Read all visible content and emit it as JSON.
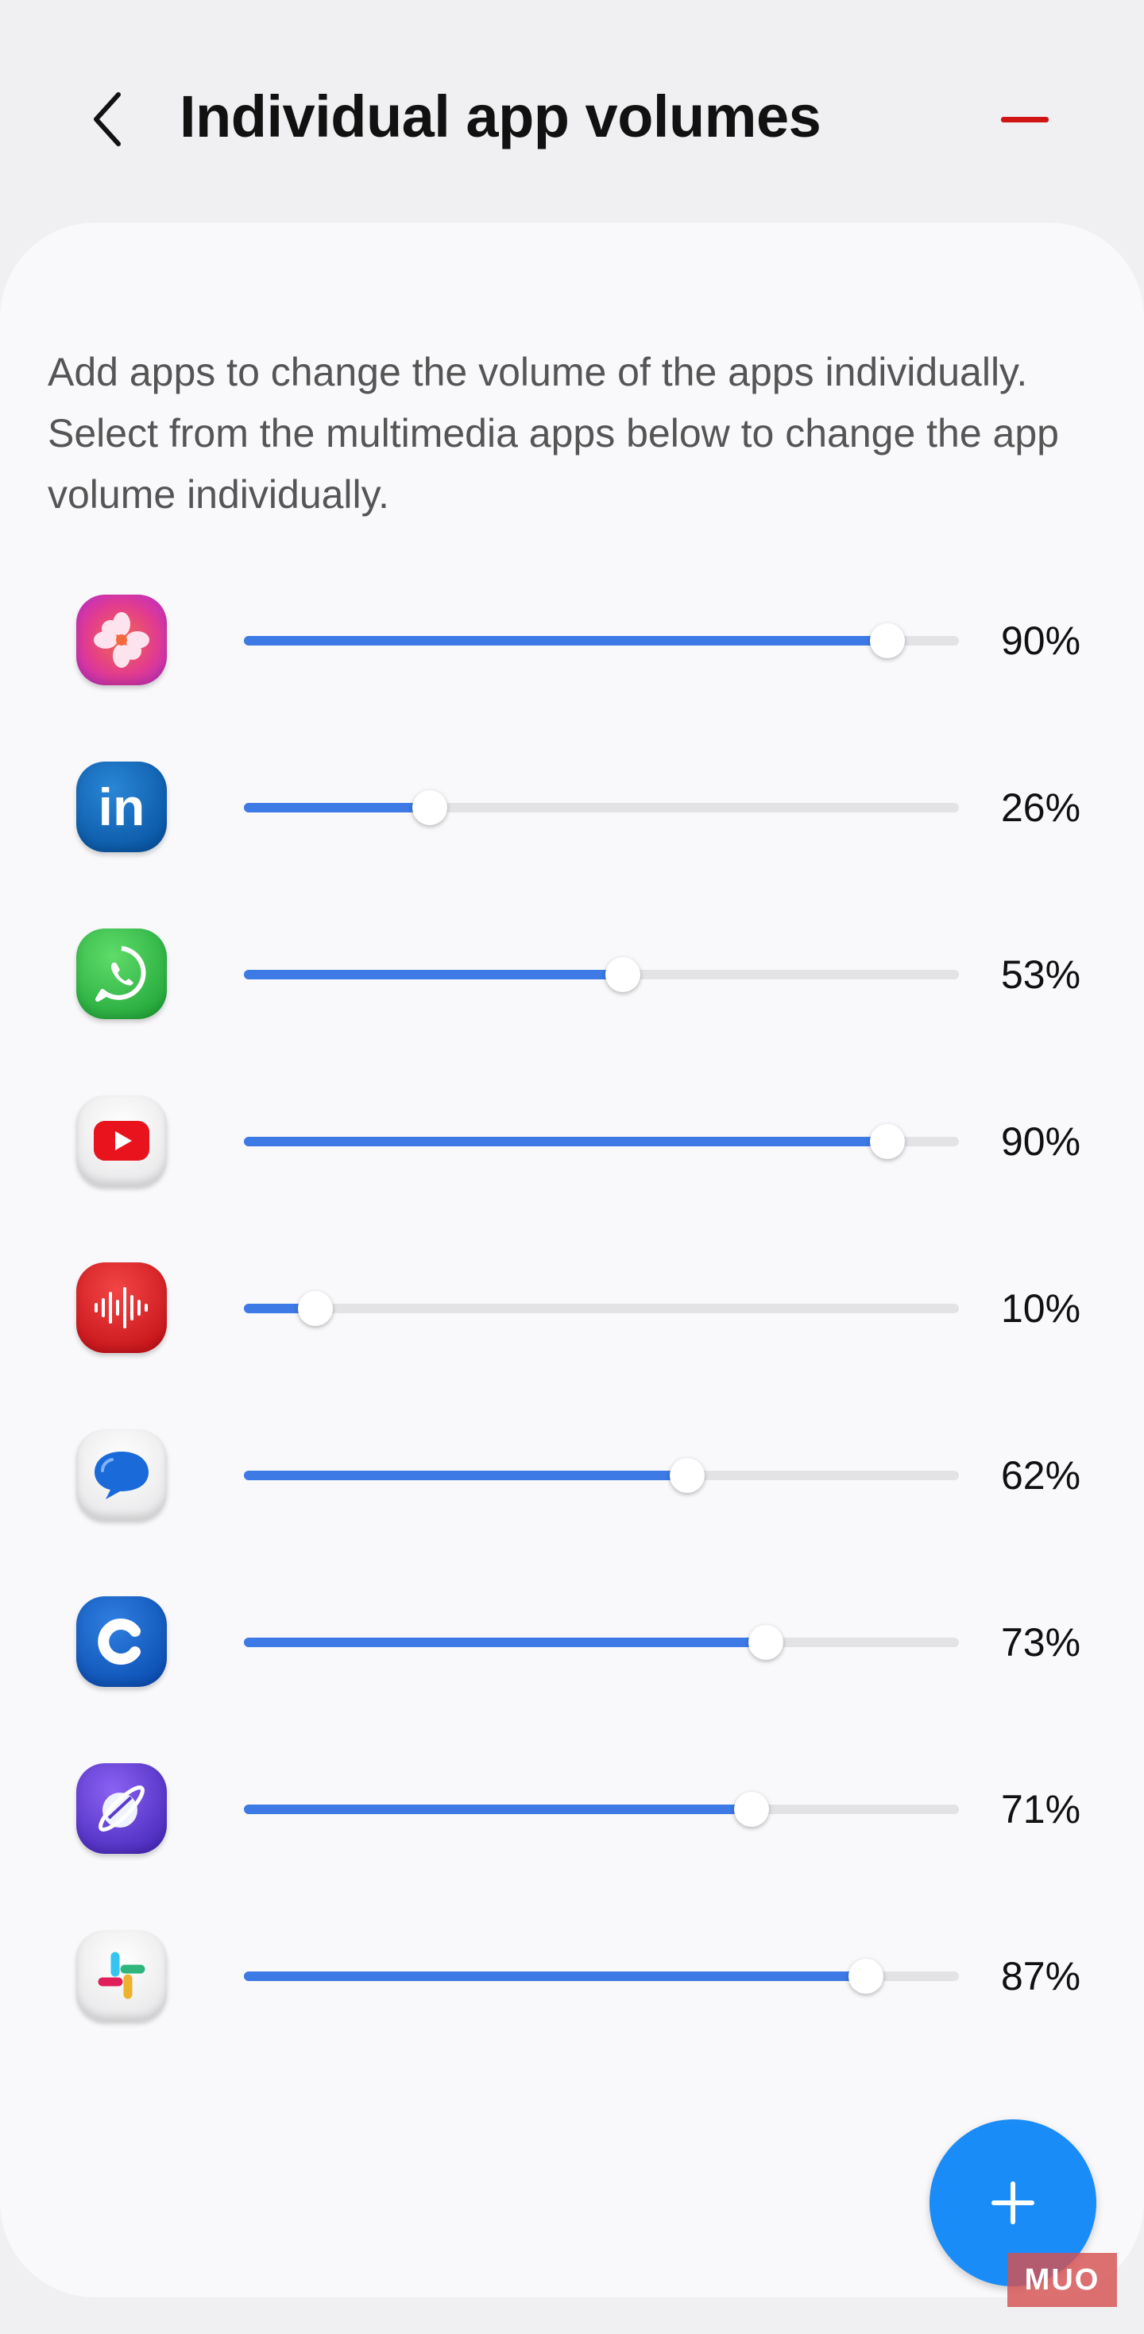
{
  "header": {
    "title": "Individual app volumes",
    "back_icon": "chevron-left-icon",
    "remove_icon": "minus-icon",
    "remove_color": "#d01414"
  },
  "description": "Add apps to change the volume of the apps individually. Select from the multimedia apps below to change the app volume individually.",
  "accent_color": "#3d7ae6",
  "apps": [
    {
      "icon": "gallery-flower-icon",
      "volume": 0.9,
      "percent_label": "90%"
    },
    {
      "icon": "linkedin-icon",
      "volume": 0.26,
      "percent_label": "26%"
    },
    {
      "icon": "whatsapp-icon",
      "volume": 0.53,
      "percent_label": "53%"
    },
    {
      "icon": "youtube-icon",
      "volume": 0.9,
      "percent_label": "90%"
    },
    {
      "icon": "voice-recorder-icon",
      "volume": 0.1,
      "percent_label": "10%"
    },
    {
      "icon": "messages-icon",
      "volume": 0.62,
      "percent_label": "62%"
    },
    {
      "icon": "c-app-icon",
      "volume": 0.73,
      "percent_label": "73%"
    },
    {
      "icon": "samsung-internet-icon",
      "volume": 0.71,
      "percent_label": "71%"
    },
    {
      "icon": "slack-icon",
      "volume": 0.87,
      "percent_label": "87%"
    }
  ],
  "fab": {
    "icon": "plus-icon",
    "color": "#1a8cf7"
  },
  "watermark": {
    "text": "MUO"
  }
}
